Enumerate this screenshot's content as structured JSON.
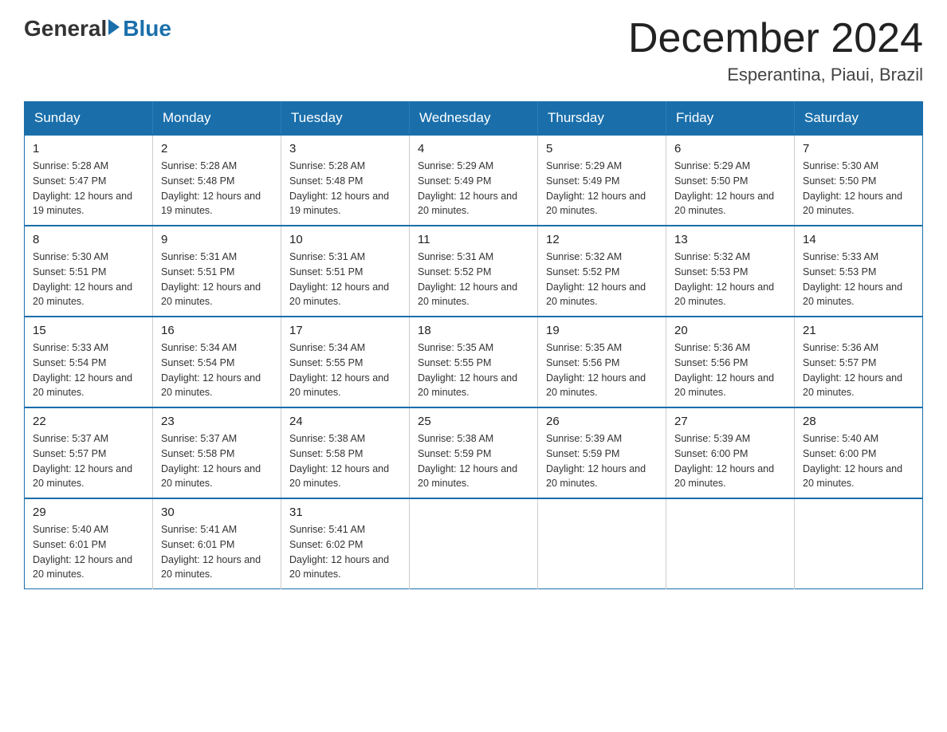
{
  "logo": {
    "general": "General",
    "blue": "Blue"
  },
  "title": "December 2024",
  "location": "Esperantina, Piaui, Brazil",
  "days_of_week": [
    "Sunday",
    "Monday",
    "Tuesday",
    "Wednesday",
    "Thursday",
    "Friday",
    "Saturday"
  ],
  "weeks": [
    [
      {
        "day": "1",
        "sunrise": "5:28 AM",
        "sunset": "5:47 PM",
        "daylight": "12 hours and 19 minutes."
      },
      {
        "day": "2",
        "sunrise": "5:28 AM",
        "sunset": "5:48 PM",
        "daylight": "12 hours and 19 minutes."
      },
      {
        "day": "3",
        "sunrise": "5:28 AM",
        "sunset": "5:48 PM",
        "daylight": "12 hours and 19 minutes."
      },
      {
        "day": "4",
        "sunrise": "5:29 AM",
        "sunset": "5:49 PM",
        "daylight": "12 hours and 20 minutes."
      },
      {
        "day": "5",
        "sunrise": "5:29 AM",
        "sunset": "5:49 PM",
        "daylight": "12 hours and 20 minutes."
      },
      {
        "day": "6",
        "sunrise": "5:29 AM",
        "sunset": "5:50 PM",
        "daylight": "12 hours and 20 minutes."
      },
      {
        "day": "7",
        "sunrise": "5:30 AM",
        "sunset": "5:50 PM",
        "daylight": "12 hours and 20 minutes."
      }
    ],
    [
      {
        "day": "8",
        "sunrise": "5:30 AM",
        "sunset": "5:51 PM",
        "daylight": "12 hours and 20 minutes."
      },
      {
        "day": "9",
        "sunrise": "5:31 AM",
        "sunset": "5:51 PM",
        "daylight": "12 hours and 20 minutes."
      },
      {
        "day": "10",
        "sunrise": "5:31 AM",
        "sunset": "5:51 PM",
        "daylight": "12 hours and 20 minutes."
      },
      {
        "day": "11",
        "sunrise": "5:31 AM",
        "sunset": "5:52 PM",
        "daylight": "12 hours and 20 minutes."
      },
      {
        "day": "12",
        "sunrise": "5:32 AM",
        "sunset": "5:52 PM",
        "daylight": "12 hours and 20 minutes."
      },
      {
        "day": "13",
        "sunrise": "5:32 AM",
        "sunset": "5:53 PM",
        "daylight": "12 hours and 20 minutes."
      },
      {
        "day": "14",
        "sunrise": "5:33 AM",
        "sunset": "5:53 PM",
        "daylight": "12 hours and 20 minutes."
      }
    ],
    [
      {
        "day": "15",
        "sunrise": "5:33 AM",
        "sunset": "5:54 PM",
        "daylight": "12 hours and 20 minutes."
      },
      {
        "day": "16",
        "sunrise": "5:34 AM",
        "sunset": "5:54 PM",
        "daylight": "12 hours and 20 minutes."
      },
      {
        "day": "17",
        "sunrise": "5:34 AM",
        "sunset": "5:55 PM",
        "daylight": "12 hours and 20 minutes."
      },
      {
        "day": "18",
        "sunrise": "5:35 AM",
        "sunset": "5:55 PM",
        "daylight": "12 hours and 20 minutes."
      },
      {
        "day": "19",
        "sunrise": "5:35 AM",
        "sunset": "5:56 PM",
        "daylight": "12 hours and 20 minutes."
      },
      {
        "day": "20",
        "sunrise": "5:36 AM",
        "sunset": "5:56 PM",
        "daylight": "12 hours and 20 minutes."
      },
      {
        "day": "21",
        "sunrise": "5:36 AM",
        "sunset": "5:57 PM",
        "daylight": "12 hours and 20 minutes."
      }
    ],
    [
      {
        "day": "22",
        "sunrise": "5:37 AM",
        "sunset": "5:57 PM",
        "daylight": "12 hours and 20 minutes."
      },
      {
        "day": "23",
        "sunrise": "5:37 AM",
        "sunset": "5:58 PM",
        "daylight": "12 hours and 20 minutes."
      },
      {
        "day": "24",
        "sunrise": "5:38 AM",
        "sunset": "5:58 PM",
        "daylight": "12 hours and 20 minutes."
      },
      {
        "day": "25",
        "sunrise": "5:38 AM",
        "sunset": "5:59 PM",
        "daylight": "12 hours and 20 minutes."
      },
      {
        "day": "26",
        "sunrise": "5:39 AM",
        "sunset": "5:59 PM",
        "daylight": "12 hours and 20 minutes."
      },
      {
        "day": "27",
        "sunrise": "5:39 AM",
        "sunset": "6:00 PM",
        "daylight": "12 hours and 20 minutes."
      },
      {
        "day": "28",
        "sunrise": "5:40 AM",
        "sunset": "6:00 PM",
        "daylight": "12 hours and 20 minutes."
      }
    ],
    [
      {
        "day": "29",
        "sunrise": "5:40 AM",
        "sunset": "6:01 PM",
        "daylight": "12 hours and 20 minutes."
      },
      {
        "day": "30",
        "sunrise": "5:41 AM",
        "sunset": "6:01 PM",
        "daylight": "12 hours and 20 minutes."
      },
      {
        "day": "31",
        "sunrise": "5:41 AM",
        "sunset": "6:02 PM",
        "daylight": "12 hours and 20 minutes."
      },
      null,
      null,
      null,
      null
    ]
  ]
}
